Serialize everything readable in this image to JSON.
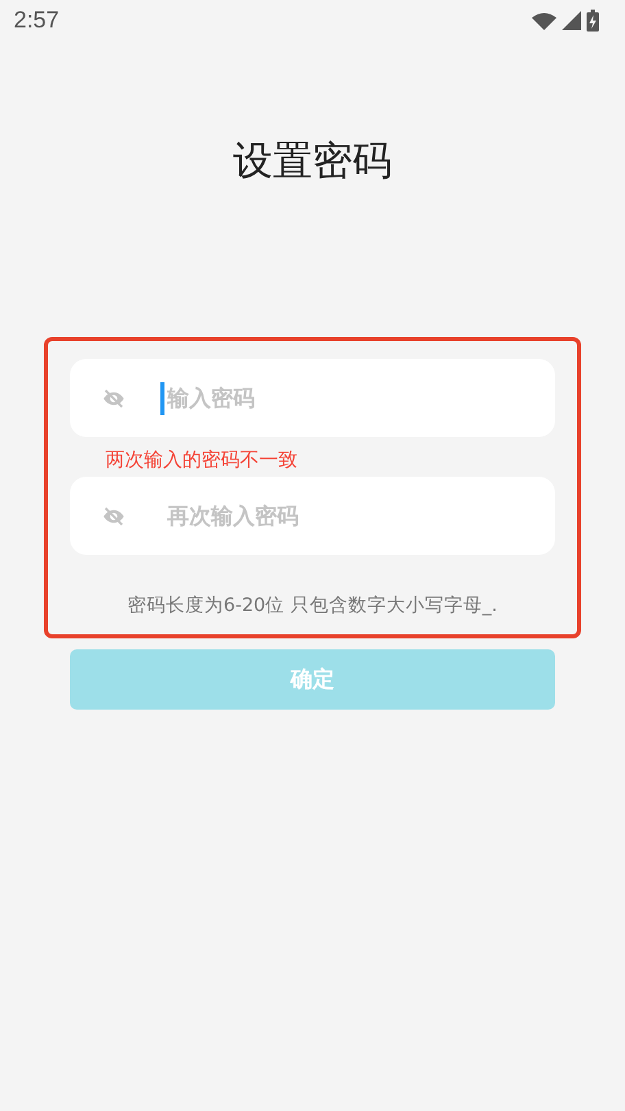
{
  "status_bar": {
    "time": "2:57"
  },
  "title": "设置密码",
  "fields": [
    {
      "placeholder": "输入密码",
      "focused": true
    },
    {
      "placeholder": "再次输入密码",
      "focused": false
    }
  ],
  "error": "两次输入的密码不一致",
  "hint": "密码长度为6-20位 只包含数字大小写字母_.",
  "confirm_button": {
    "label": "确定",
    "disabled": true
  }
}
